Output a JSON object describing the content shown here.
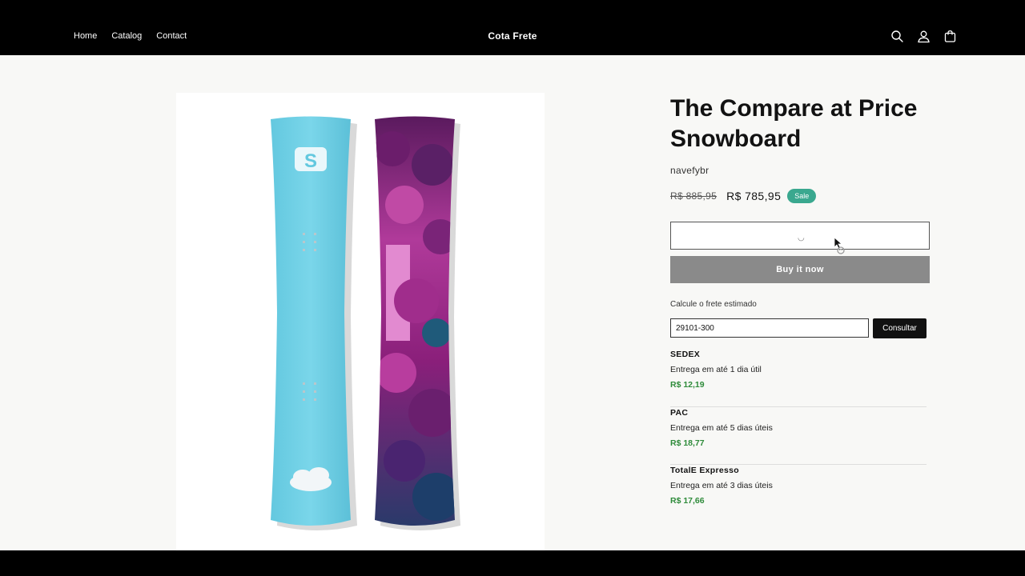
{
  "header": {
    "nav": [
      "Home",
      "Catalog",
      "Contact"
    ],
    "brand": "Cota Frete",
    "icons": [
      "search-icon",
      "account-icon",
      "cart-icon"
    ]
  },
  "product": {
    "title": "The Compare at Price Snowboard",
    "vendor": "navefybr",
    "compare_price": "R$ 885,95",
    "price": "R$ 785,95",
    "badge": "Sale",
    "add_to_cart_state": "loading",
    "buy_now_label": "Buy it now"
  },
  "freight": {
    "label": "Calcule o frete estimado",
    "cep_value": "29101-300",
    "button_label": "Consultar",
    "rates": [
      {
        "name": "SEDEX",
        "delivery": "Entrega em até 1 dia útil",
        "price": "R$ 12,19"
      },
      {
        "name": "PAC",
        "delivery": "Entrega em até 5 dias úteis",
        "price": "R$ 18,77"
      },
      {
        "name": "TotalE Expresso",
        "delivery": "Entrega em até 3 dias úteis",
        "price": "R$ 17,66"
      }
    ]
  },
  "colors": {
    "header_bg": "#000000",
    "page_bg": "#f8f8f6",
    "sale_badge": "#3aa88f",
    "rate_price": "#2e8b3a",
    "buy_now_bg": "#8a8a8a",
    "board_blue": "#6cd0e6",
    "board_purple": "#8a1f7a"
  }
}
